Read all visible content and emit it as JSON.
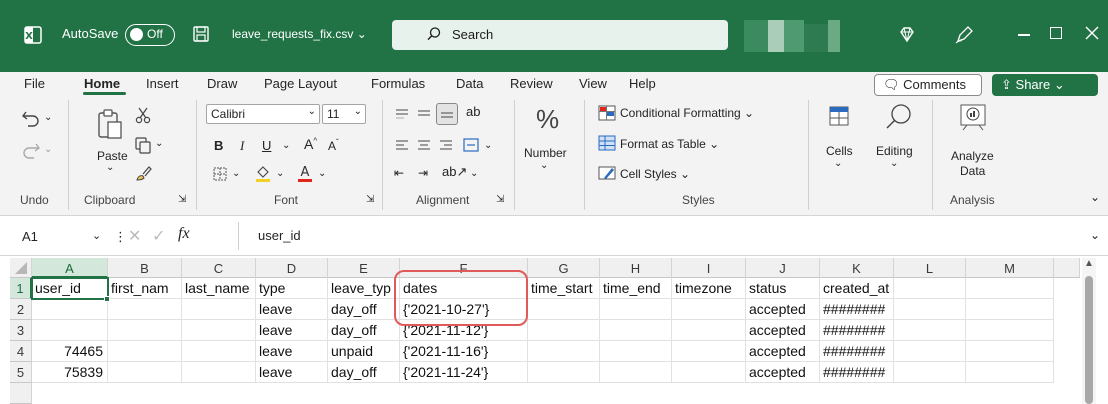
{
  "titlebar": {
    "autosave_label": "AutoSave",
    "autosave_state": "Off",
    "filename": "leave_requests_fix.csv ⌄",
    "search_placeholder": "Search"
  },
  "menu": {
    "items": [
      "File",
      "Home",
      "Insert",
      "Draw",
      "Page Layout",
      "Formulas",
      "Data",
      "Review",
      "View",
      "Help"
    ],
    "active": "Home",
    "comments": "Comments",
    "share": "Share"
  },
  "ribbon": {
    "groups": {
      "undo": "Undo",
      "clipboard": "Clipboard",
      "font": "Font",
      "alignment": "Alignment",
      "styles": "Styles",
      "analysis": "Analysis"
    },
    "paste": "Paste",
    "font_name": "Calibri",
    "font_size": "11",
    "number": "Number",
    "conditional_formatting": "Conditional Formatting ⌄",
    "format_as_table": "Format as Table ⌄",
    "cell_styles": "Cell Styles ⌄",
    "cells": "Cells",
    "editing": "Editing",
    "analyze_data_1": "Analyze",
    "analyze_data_2": "Data"
  },
  "formula_bar": {
    "name_box": "A1",
    "formula": "user_id"
  },
  "sheet": {
    "columns": [
      "A",
      "B",
      "C",
      "D",
      "E",
      "F",
      "G",
      "H",
      "I",
      "J",
      "K",
      "L",
      "M"
    ],
    "row_numbers": [
      "1",
      "2",
      "3",
      "4",
      "5"
    ],
    "rows": [
      [
        "user_id",
        "first_nam",
        "last_name",
        "type",
        "leave_typ",
        "dates",
        "time_start",
        "time_end",
        "timezone",
        "status",
        "created_at",
        "",
        ""
      ],
      [
        "",
        "",
        "",
        "leave",
        "day_off",
        "{'2021-10-27'}",
        "",
        "",
        "",
        "accepted",
        "########",
        "",
        ""
      ],
      [
        "",
        "",
        "",
        "leave",
        "day_off",
        "{'2021-11-12'}",
        "",
        "",
        "",
        "accepted",
        "########",
        "",
        ""
      ],
      [
        "74465",
        "",
        "",
        "leave",
        "unpaid",
        "{'2021-11-16'}",
        "",
        "",
        "",
        "accepted",
        "########",
        "",
        ""
      ],
      [
        "75839",
        "",
        "",
        "leave",
        "day_off",
        "{'2021-11-24'}",
        "",
        "",
        "",
        "accepted",
        "########",
        "",
        ""
      ]
    ]
  },
  "colors": {
    "excel_green": "#217346",
    "highlight_red": "#e05a5a"
  }
}
